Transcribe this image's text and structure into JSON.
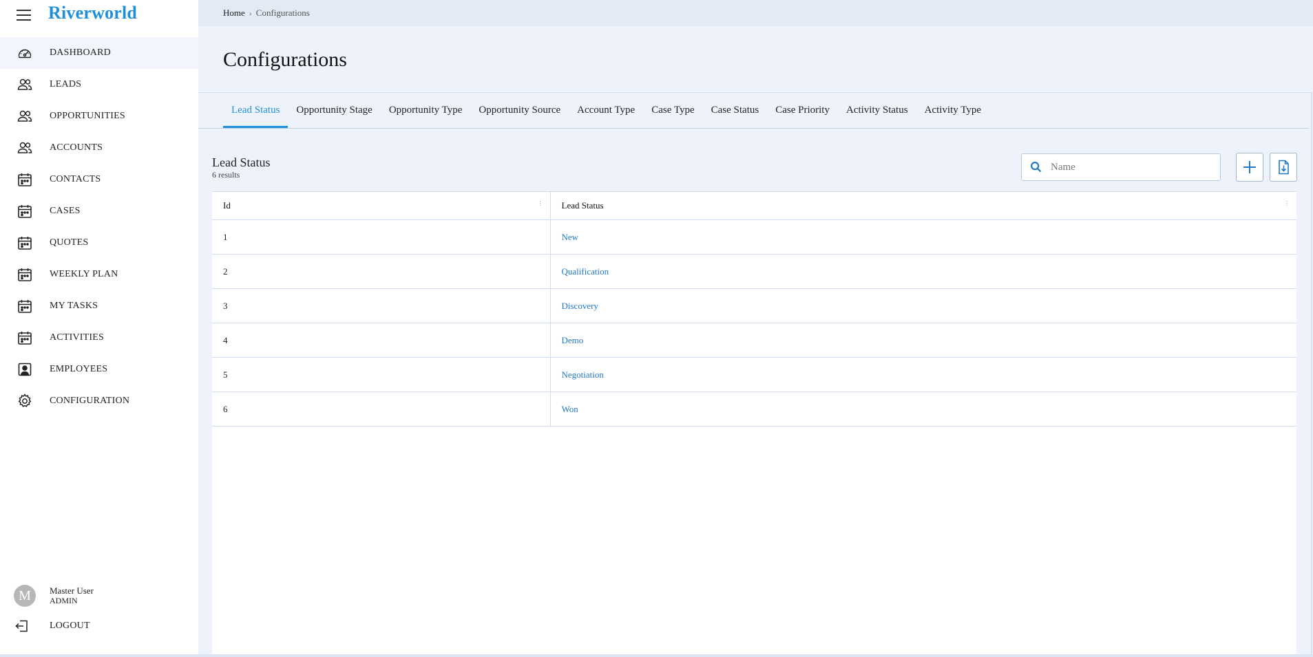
{
  "app": {
    "name": "Riverworld"
  },
  "sidebar": {
    "items": [
      {
        "label": "DASHBOARD",
        "icon": "gauge-icon"
      },
      {
        "label": "LEADS",
        "icon": "users-icon"
      },
      {
        "label": "OPPORTUNITIES",
        "icon": "users-icon"
      },
      {
        "label": "ACCOUNTS",
        "icon": "users-icon"
      },
      {
        "label": "CONTACTS",
        "icon": "calendar-icon"
      },
      {
        "label": "CASES",
        "icon": "calendar-icon"
      },
      {
        "label": "QUOTES",
        "icon": "calendar-icon"
      },
      {
        "label": "WEEKLY PLAN",
        "icon": "calendar-icon"
      },
      {
        "label": "MY TASKS",
        "icon": "calendar-icon"
      },
      {
        "label": "ACTIVITIES",
        "icon": "calendar-icon"
      },
      {
        "label": "EMPLOYEES",
        "icon": "employee-badge-icon"
      },
      {
        "label": "CONFIGURATION",
        "icon": "gear-icon"
      }
    ],
    "user": {
      "initial": "M",
      "name": "Master User",
      "role": "ADMIN"
    },
    "logout_label": "LOGOUT"
  },
  "breadcrumb": {
    "home": "Home",
    "separator": "›",
    "current": "Configurations"
  },
  "page": {
    "title": "Configurations"
  },
  "tabs": [
    {
      "label": "Lead Status",
      "active": true
    },
    {
      "label": "Opportunity Stage"
    },
    {
      "label": "Opportunity Type"
    },
    {
      "label": "Opportunity Source"
    },
    {
      "label": "Account Type"
    },
    {
      "label": "Case Type"
    },
    {
      "label": "Case Status"
    },
    {
      "label": "Case Priority"
    },
    {
      "label": "Activity Status"
    },
    {
      "label": "Activity Type"
    }
  ],
  "panel": {
    "title": "Lead Status",
    "count": "6 results",
    "search_placeholder": "Name"
  },
  "table": {
    "columns": [
      "Id",
      "Lead Status"
    ],
    "rows": [
      {
        "id": "1",
        "status": "New"
      },
      {
        "id": "2",
        "status": "Qualification"
      },
      {
        "id": "3",
        "status": "Discovery"
      },
      {
        "id": "4",
        "status": "Demo"
      },
      {
        "id": "5",
        "status": "Negotiation"
      },
      {
        "id": "6",
        "status": "Won"
      }
    ]
  },
  "colors": {
    "accent": "#1e8fd8",
    "link": "#1e78c8",
    "background": "#eef3fb"
  }
}
